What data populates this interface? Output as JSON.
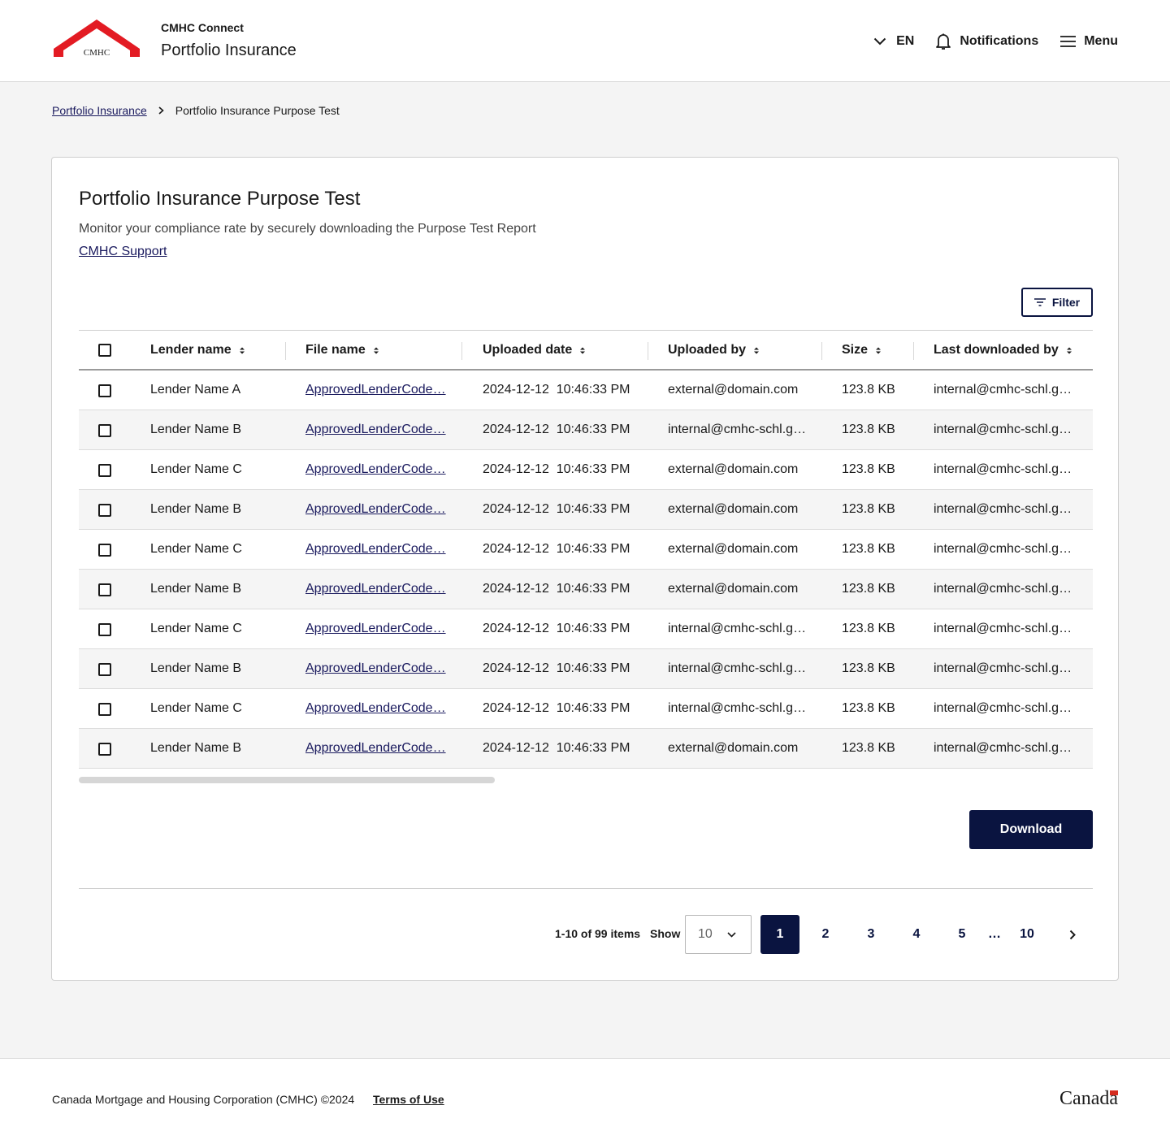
{
  "header": {
    "logo_text": "CMHC✦SCHL",
    "app_name": "CMHC Connect",
    "title": "Portfolio Insurance",
    "lang": "EN",
    "notifications": "Notifications",
    "menu": "Menu"
  },
  "breadcrumb": {
    "parent": "Portfolio Insurance",
    "current": "Portfolio Insurance Purpose Test"
  },
  "card": {
    "title": "Portfolio Insurance Purpose Test",
    "description": "Monitor your compliance rate by securely downloading the Purpose Test Report",
    "support_link": "CMHC Support",
    "filter": "Filter",
    "download": "Download"
  },
  "table": {
    "columns": [
      "Lender name",
      "File name",
      "Uploaded date",
      "Uploaded by",
      "Size",
      "Last downloaded by"
    ],
    "rows": [
      [
        "Lender Name A",
        "ApprovedLenderCode…",
        "2024-12-12  10:46:33 PM",
        "external@domain.com",
        "123.8 KB",
        "internal@cmhc-schl.g…"
      ],
      [
        "Lender Name B",
        "ApprovedLenderCode…",
        "2024-12-12  10:46:33 PM",
        "internal@cmhc-schl.g…",
        "123.8 KB",
        "internal@cmhc-schl.g…"
      ],
      [
        "Lender Name C",
        "ApprovedLenderCode…",
        "2024-12-12  10:46:33 PM",
        "external@domain.com",
        "123.8 KB",
        "internal@cmhc-schl.g…"
      ],
      [
        "Lender Name B",
        "ApprovedLenderCode…",
        "2024-12-12  10:46:33 PM",
        "external@domain.com",
        "123.8 KB",
        "internal@cmhc-schl.g…"
      ],
      [
        "Lender Name C",
        "ApprovedLenderCode…",
        "2024-12-12  10:46:33 PM",
        "external@domain.com",
        "123.8 KB",
        "internal@cmhc-schl.g…"
      ],
      [
        "Lender Name B",
        "ApprovedLenderCode…",
        "2024-12-12  10:46:33 PM",
        "external@domain.com",
        "123.8 KB",
        "internal@cmhc-schl.g…"
      ],
      [
        "Lender Name C",
        "ApprovedLenderCode…",
        "2024-12-12  10:46:33 PM",
        "internal@cmhc-schl.g…",
        "123.8 KB",
        "internal@cmhc-schl.g…"
      ],
      [
        "Lender Name B",
        "ApprovedLenderCode…",
        "2024-12-12  10:46:33 PM",
        "internal@cmhc-schl.g…",
        "123.8 KB",
        "internal@cmhc-schl.g…"
      ],
      [
        "Lender Name C",
        "ApprovedLenderCode…",
        "2024-12-12  10:46:33 PM",
        "internal@cmhc-schl.g…",
        "123.8 KB",
        "internal@cmhc-schl.g…"
      ],
      [
        "Lender Name B",
        "ApprovedLenderCode…",
        "2024-12-12  10:46:33 PM",
        "external@domain.com",
        "123.8 KB",
        "internal@cmhc-schl.g…"
      ]
    ]
  },
  "pagination": {
    "info": "1-10 of 99 items",
    "show_label": "Show",
    "page_size": "10",
    "pages": [
      "1",
      "2",
      "3",
      "4",
      "5",
      "…",
      "10"
    ],
    "current_page": "1"
  },
  "footer": {
    "copyright": "Canada Mortgage and Housing Corporation (CMHC) ©2024",
    "terms": "Terms of Use",
    "wordmark": "Canadā"
  },
  "colors": {
    "brand_red": "#e31b23",
    "primary_navy": "#0a1440",
    "link": "#1a1a5e"
  }
}
